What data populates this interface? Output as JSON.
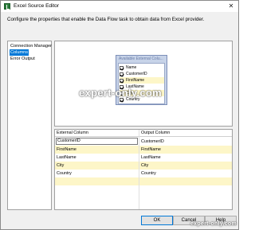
{
  "window": {
    "title": "Excel Source Editor",
    "close_glyph": "✕"
  },
  "description": "Configure the properties that enable the Data Flow task to obtain data from Excel provider.",
  "nav": {
    "items": [
      {
        "label": "Connection Manager",
        "selected": false
      },
      {
        "label": "Columns",
        "selected": true
      },
      {
        "label": "Error Output",
        "selected": false
      }
    ]
  },
  "available_columns": {
    "header": "Available External Colu...",
    "items": [
      {
        "label": "Name",
        "checked": true
      },
      {
        "label": "CustomerID",
        "checked": true
      },
      {
        "label": "FirstName",
        "checked": true
      },
      {
        "label": "LastName",
        "checked": true
      },
      {
        "label": "City",
        "checked": true
      },
      {
        "label": "Country",
        "checked": true
      }
    ]
  },
  "mapping": {
    "headers": [
      "External Column",
      "Output Column"
    ],
    "rows": [
      {
        "external": "CustomerID",
        "output": "CustomerID"
      },
      {
        "external": "FirstName",
        "output": "FirstName"
      },
      {
        "external": "LastName",
        "output": "LastName"
      },
      {
        "external": "City",
        "output": "City"
      },
      {
        "external": "Country",
        "output": "Country"
      }
    ]
  },
  "watermark": {
    "large": "expert-only.com",
    "small": "expert-only.com"
  },
  "buttons": {
    "ok": "OK",
    "cancel": "Cancel",
    "help": "Help"
  }
}
